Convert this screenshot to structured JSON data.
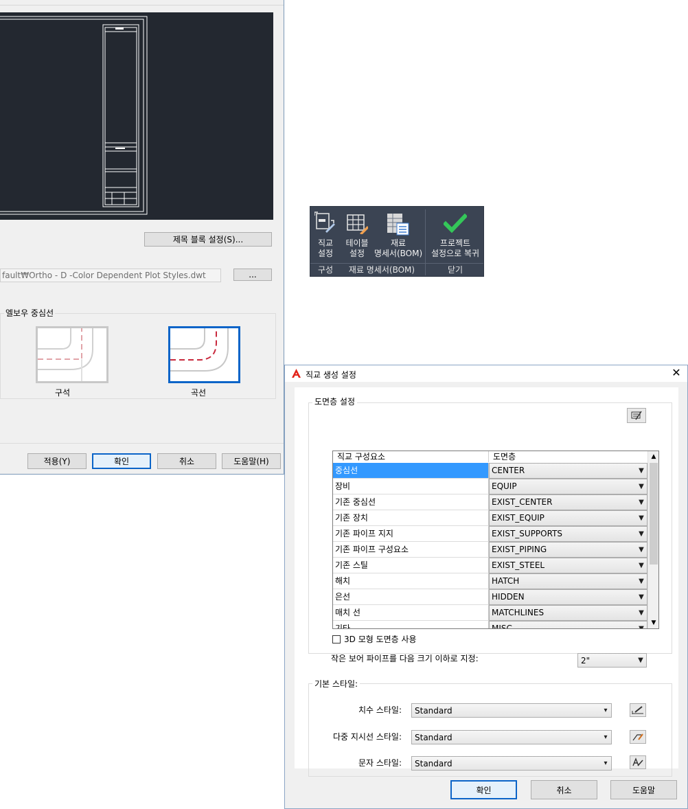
{
  "left_dialog": {
    "title_block_button": "제목 블록 설정(S)...",
    "template_path": "fault₩Ortho - D -Color Dependent Plot Styles.dwt",
    "browse_button": "...",
    "elbow_group_title": "엘보우 중심선",
    "elbow_options": [
      {
        "label": "구석",
        "selected": false
      },
      {
        "label": "곡선",
        "selected": true
      }
    ],
    "buttons": {
      "apply": "적용(Y)",
      "ok": "확인",
      "cancel": "취소",
      "help": "도움말(H)"
    }
  },
  "ribbon": {
    "buttons": [
      {
        "line1": "직교",
        "line2": "설정",
        "icon": "ortho-settings-icon"
      },
      {
        "line1": "테이블",
        "line2": "설정",
        "icon": "table-settings-icon"
      },
      {
        "line1": "재료",
        "line2": "명세서(BOM)",
        "icon": "bom-icon"
      },
      {
        "line1": "프로젝트",
        "line2": "설정으로 복귀",
        "icon": "checkmark-icon"
      }
    ],
    "panels": {
      "setup": "구성",
      "bom": "재료 명세서(BOM)",
      "close": "닫기"
    }
  },
  "right_dialog": {
    "title": "직교 생성 설정",
    "layer_settings": {
      "title": "도면층 설정",
      "columns": [
        "직교 구성요소",
        "도면층"
      ],
      "rows": [
        {
          "component": "중심선",
          "layer": "CENTER"
        },
        {
          "component": "장비",
          "layer": "EQUIP"
        },
        {
          "component": "기존 중심선",
          "layer": "EXIST_CENTER"
        },
        {
          "component": "기존 장치",
          "layer": "EXIST_EQUIP"
        },
        {
          "component": "기존 파이프 지지",
          "layer": "EXIST_SUPPORTS"
        },
        {
          "component": "기존 파이프 구성요소",
          "layer": "EXIST_PIPING"
        },
        {
          "component": "기존 스틸",
          "layer": "EXIST_STEEL"
        },
        {
          "component": "해치",
          "layer": "HATCH"
        },
        {
          "component": "은선",
          "layer": "HIDDEN"
        },
        {
          "component": "매치 선",
          "layer": "MATCHLINES"
        },
        {
          "component": "기타",
          "layer": "MISC"
        }
      ],
      "use_3d_layers_label": "3D 모형 도면층 사용",
      "use_3d_layers_checked": false,
      "small_bore_label": "작은 보어 파이프를 다음 크기 이하로 지정:",
      "small_bore_value": "2\""
    },
    "default_styles": {
      "title": "기본 스타일:",
      "dimension_label": "치수 스타일:",
      "dimension_value": "Standard",
      "multileader_label": "다중 지시선 스타일:",
      "multileader_value": "Standard",
      "text_label": "문자 스타일:",
      "text_value": "Standard"
    },
    "buttons": {
      "ok": "확인",
      "cancel": "취소",
      "help": "도움말"
    }
  },
  "colors": {
    "accent": "#0a64c8",
    "selection": "#3399ff",
    "ribbon_bg": "#3b4453",
    "preview_bg": "#232830",
    "check_green": "#34c759"
  }
}
